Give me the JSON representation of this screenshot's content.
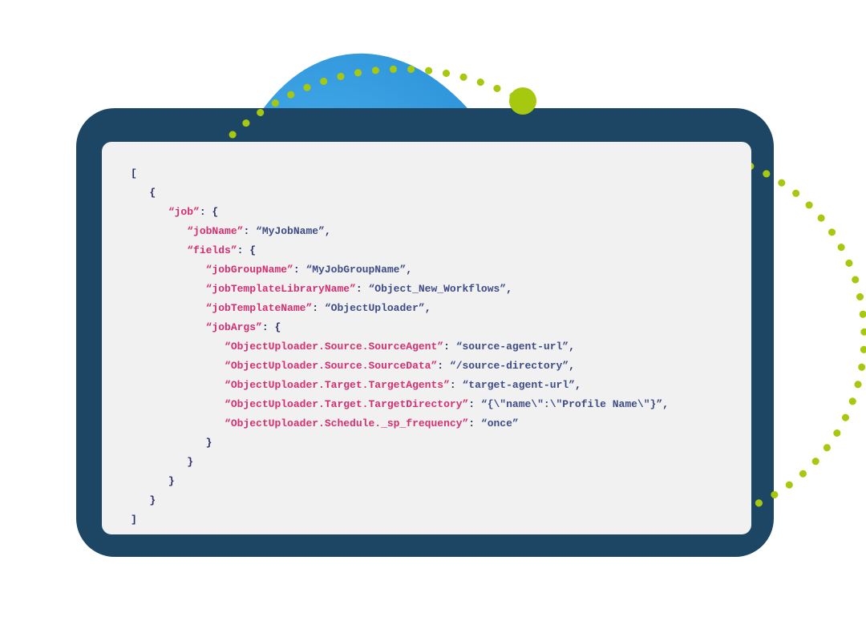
{
  "colors": {
    "accent_green": "#a6c90f",
    "panel_navy": "#1d4665",
    "card_bg": "#f1f1f1",
    "key_color": "#d52f6f",
    "value_color": "#3d4c87"
  },
  "code": {
    "root": {
      "job": {
        "jobName": "MyJobName",
        "fields": {
          "jobGroupName": "MyJobGroupName",
          "jobTemplateLibraryName": "Object_New_Workflows",
          "jobTemplateName": "ObjectUploader",
          "jobArgs": {
            "ObjectUploader.Source.SourceAgent": "source-agent-url",
            "ObjectUploader.Source.SourceData": "/source-directory",
            "ObjectUploader.Target.TargetAgents": "target-agent-url",
            "ObjectUploader.Target.TargetDirectory": "{\\\"name\\\":\\\"Profile Name\\\"}",
            "ObjectUploader.Schedule._sp_frequency": "once"
          }
        }
      }
    },
    "lines": [
      {
        "indent": 0,
        "type": "punct",
        "text": "["
      },
      {
        "indent": 1,
        "type": "punct",
        "text": "{"
      },
      {
        "indent": 2,
        "type": "key-open",
        "key": "job"
      },
      {
        "indent": 3,
        "type": "kv",
        "key": "jobName",
        "val": "MyJobName",
        "trailing_comma": true
      },
      {
        "indent": 3,
        "type": "key-open",
        "key": "fields"
      },
      {
        "indent": 4,
        "type": "kv",
        "key": "jobGroupName",
        "val": "MyJobGroupName",
        "trailing_comma": true
      },
      {
        "indent": 4,
        "type": "kv",
        "key": "jobTemplateLibraryName",
        "val": "Object_New_Workflows",
        "trailing_comma": true
      },
      {
        "indent": 4,
        "type": "kv",
        "key": "jobTemplateName",
        "val": "ObjectUploader",
        "trailing_comma": true
      },
      {
        "indent": 4,
        "type": "key-open",
        "key": "jobArgs"
      },
      {
        "indent": 5,
        "type": "kv",
        "key": "ObjectUploader.Source.SourceAgent",
        "val": "source-agent-url",
        "trailing_comma": true
      },
      {
        "indent": 5,
        "type": "kv",
        "key": "ObjectUploader.Source.SourceData",
        "val": "/source-directory",
        "trailing_comma": true
      },
      {
        "indent": 5,
        "type": "kv",
        "key": "ObjectUploader.Target.TargetAgents",
        "val": "target-agent-url",
        "trailing_comma": true
      },
      {
        "indent": 5,
        "type": "kv",
        "key": "ObjectUploader.Target.TargetDirectory",
        "val": "{\\\"name\\\":\\\"Profile Name\\\"}",
        "trailing_comma": true
      },
      {
        "indent": 5,
        "type": "kv",
        "key": "ObjectUploader.Schedule._sp_frequency",
        "val": "once",
        "trailing_comma": false
      },
      {
        "indent": 4,
        "type": "punct",
        "text": "}"
      },
      {
        "indent": 3,
        "type": "punct",
        "text": "}"
      },
      {
        "indent": 2,
        "type": "punct",
        "text": "}"
      },
      {
        "indent": 1,
        "type": "punct",
        "text": "}"
      },
      {
        "indent": 0,
        "type": "punct",
        "text": "]"
      }
    ]
  }
}
